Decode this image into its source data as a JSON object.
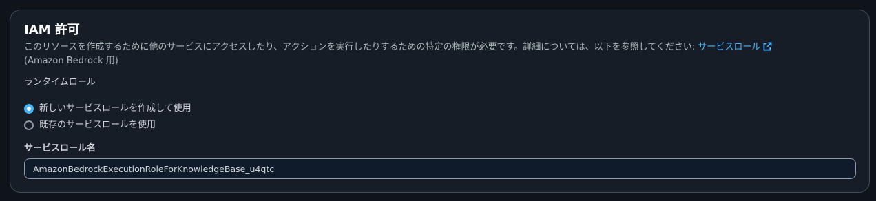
{
  "section": {
    "title": "IAM 許可",
    "description_main": "このリソースを作成するために他のサービスにアクセスしたり、アクションを実行したりするための特定の権限が必要です。詳細については、以下を参照してください: ",
    "description_link": "サービスロール",
    "description_suffix": "(Amazon Bedrock 用)",
    "link_icon": "external-link-icon"
  },
  "runtime_role": {
    "label": "ランタイムロール",
    "options": [
      {
        "label": "新しいサービスロールを作成して使用",
        "selected": true
      },
      {
        "label": "既存のサービスロールを使用",
        "selected": false
      }
    ]
  },
  "service_role_name": {
    "label": "サービスロール名",
    "value": "AmazonBedrockExecutionRoleForKnowledgeBase_u4qtc"
  },
  "colors": {
    "accent": "#42b4ff",
    "background": "#161d26",
    "border": "#414d5c"
  }
}
